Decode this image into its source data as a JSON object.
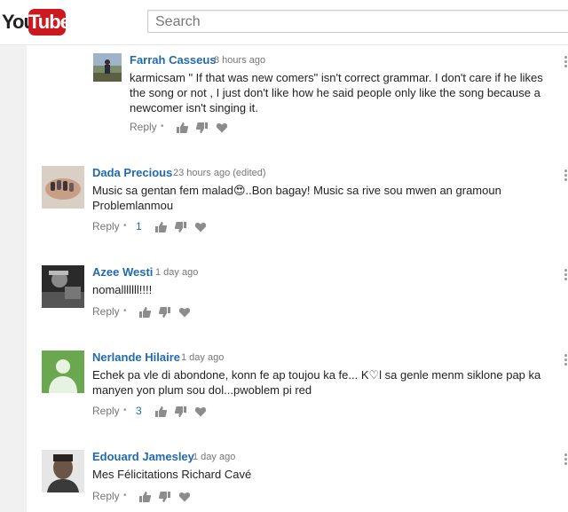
{
  "header": {
    "logo_text_you": "You",
    "logo_text_tube": "Tube",
    "search_placeholder": "Search"
  },
  "comments": [
    {
      "author": "Farrah Casseus",
      "time": "8 hours ago",
      "text_lines": [
        "karmicsam \" If that was new comers\" isn't correct grammar. I don't care if he likes",
        "the song or not , I just don't like how he said people only like the song because a",
        "newcomer isn't singing it."
      ],
      "reply_label": "Reply",
      "likes": ""
    },
    {
      "author": "Dada Precious",
      "time": "23 hours ago (edited)",
      "text_lines": [
        "Music sa gentan fem malad😍..Bon bagay!  Music sa rive sou mwen an gramoun",
        "Problemlanmou"
      ],
      "reply_label": "Reply",
      "likes": "1"
    },
    {
      "author": "Azee Westi",
      "time": "1 day ago",
      "text_lines": [
        "nomalllllll!!!!"
      ],
      "reply_label": "Reply",
      "likes": ""
    },
    {
      "author": "Nerlande Hilaire",
      "time": "1 day ago",
      "text_lines": [
        "Echek pa vle di abondone, konn fe ap toujou ka fe... K♡l sa genle menm siklone pap ka",
        "manyen yon plum sou dol...pwoblem pi red"
      ],
      "reply_label": "Reply",
      "likes": "3"
    },
    {
      "author": "Edouard Jamesley",
      "time": "1 day ago",
      "text_lines": [
        "Mes Félicitations Richard Cavé"
      ],
      "reply_label": "Reply",
      "likes": ""
    }
  ],
  "icons": {
    "like": "thumbs-up-icon",
    "dislike": "thumbs-down-icon",
    "heart": "heart-icon",
    "more": "more-vertical-icon"
  },
  "colors": {
    "author": "#1f6ab0",
    "logo_red": "#cc181e"
  }
}
